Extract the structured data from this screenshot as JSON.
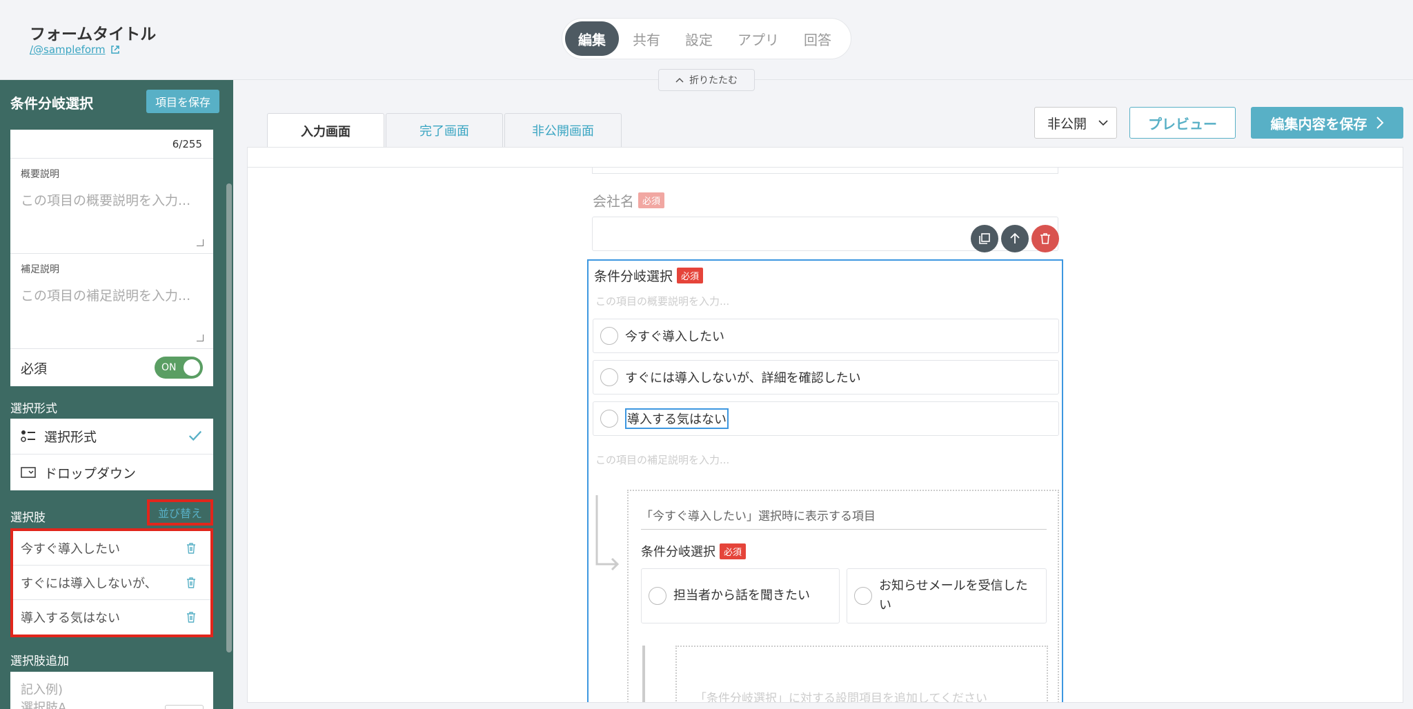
{
  "header": {
    "form_title": "フォームタイトル",
    "form_link": "/@sampleform",
    "nav": [
      "編集",
      "共有",
      "設定",
      "アプリ",
      "回答"
    ],
    "collapse_label": "折りたたむ"
  },
  "sidebar": {
    "title": "条件分岐選択",
    "save_item": "項目を保存",
    "counter": "6/255",
    "summary_label": "概要説明",
    "summary_placeholder": "この項目の概要説明を入力...",
    "supplement_label": "補足説明",
    "supplement_placeholder": "この項目の補足説明を入力...",
    "required_label": "必須",
    "toggle_label": "ON",
    "format_section": "選択形式",
    "formats": [
      {
        "label": "選択形式",
        "icon": "list-radio-icon",
        "selected": true
      },
      {
        "label": "ドロップダウン",
        "icon": "dropdown-icon",
        "selected": false
      }
    ],
    "choices_section": "選択肢",
    "sort_label": "並び替え",
    "choices": [
      "今すぐ導入したい",
      "すぐには導入しないが、",
      "導入する気はない"
    ],
    "add_section": "選択肢追加",
    "add_placeholder_1": "記入例)",
    "add_placeholder_2": "選択肢A"
  },
  "main": {
    "tabs": [
      "入力画面",
      "完了画面",
      "非公開画面"
    ],
    "visibility": "非公開",
    "preview": "プレビュー",
    "save_edit": "編集内容を保存",
    "company_label": "会社名",
    "required_badge": "必須",
    "question_title": "条件分岐選択",
    "desc_placeholder": "この項目の概要説明を入力...",
    "options": [
      "今すぐ導入したい",
      "すぐには導入しないが、詳細を確認したい",
      "導入する気はない"
    ],
    "sub_placeholder": "この項目の補足説明を入力...",
    "branch_header": "「今すぐ導入したい」選択時に表示する項目",
    "branch_question": "条件分岐選択",
    "branch_options": [
      "担当者から話を聞きたい",
      "お知らせメールを受信したい"
    ],
    "nested_placeholder": "「条件分岐選択」に対する設問項目を追加してください"
  },
  "colors": {
    "sidebar_bg": "#3d6a63",
    "accent": "#58b0c6",
    "required_red": "#e5443a",
    "selection_blue": "#3d97e0",
    "highlight_red": "#e1261c"
  }
}
